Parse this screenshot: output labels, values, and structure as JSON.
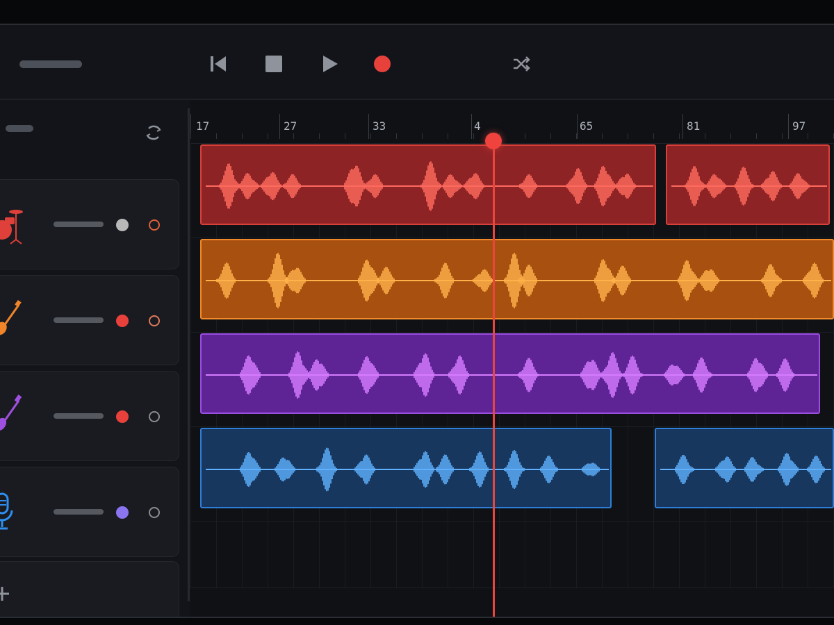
{
  "transport": {
    "buttons": [
      {
        "name": "skip-to-start-button",
        "icon": "skip-back-icon"
      },
      {
        "name": "stop-button",
        "icon": "stop-icon"
      },
      {
        "name": "play-button",
        "icon": "play-icon"
      },
      {
        "name": "record-button",
        "icon": "record-icon"
      },
      {
        "name": "shuffle-button",
        "icon": "shuffle-icon"
      }
    ],
    "record_color": "#e8413c"
  },
  "ruler": {
    "labels": [
      "17",
      "27",
      "33",
      "4",
      "65",
      "81",
      "97"
    ]
  },
  "tracks": [
    {
      "instrument": "drums",
      "icon": "drum-kit-icon",
      "color": "#e0403a",
      "mute_color": "#b8b8b8",
      "clip_fill": "#8e2326",
      "clip_border": "#d8413a",
      "wave_color": "#ff6a5e"
    },
    {
      "instrument": "electric-guitar",
      "icon": "guitar-icon",
      "color": "#f0852a",
      "mute_color": "#e8413c",
      "clip_fill": "#a8500f",
      "clip_border": "#f08a2a",
      "wave_color": "#ffb24a"
    },
    {
      "instrument": "bass-guitar",
      "icon": "bass-guitar-icon",
      "color": "#a050e0",
      "mute_color": "#e8413c",
      "clip_fill": "#5e2496",
      "clip_border": "#9b4ee0",
      "wave_color": "#d77cff"
    },
    {
      "instrument": "vocals",
      "icon": "microphone-icon",
      "color": "#2e8ff0",
      "mute_color": "#8a74f0",
      "clip_fill": "#18375e",
      "clip_border": "#2f7fd8",
      "wave_color": "#5fb0ff"
    }
  ],
  "playhead": {
    "bar": 48,
    "color": "#e8463f"
  }
}
